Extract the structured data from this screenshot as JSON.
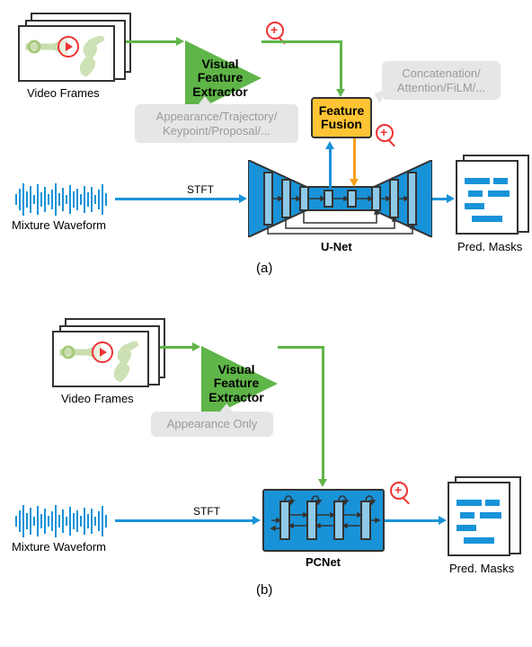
{
  "panel_a": {
    "video_frames_label": "Video Frames",
    "vfe_label": "Visual\nFeature\nExtractor",
    "vfe_callout": "Appearance/Trajectory/\nKeypoint/Proposal/...",
    "fusion_label": "Feature\nFusion",
    "fusion_callout": "Concatenation/\nAttention/FiLM/...",
    "mixture_label": "Mixture Waveform",
    "stft_label": "STFT",
    "net_label": "U-Net",
    "pred_label": "Pred. Masks",
    "subfig": "(a)"
  },
  "panel_b": {
    "video_frames_label": "Video Frames",
    "vfe_label": "Visual\nFeature\nExtractor",
    "vfe_callout": "Appearance Only",
    "mixture_label": "Mixture Waveform",
    "stft_label": "STFT",
    "net_label": "PCNet",
    "pred_label": "Pred. Masks",
    "subfig": "(b)"
  },
  "colors": {
    "green": "#5fb548",
    "blue": "#1993d8",
    "orange": "#ffc433",
    "arrow_green": "#5fb548",
    "arrow_blue": "#1993d8",
    "arrow_orange": "#f7a11a"
  },
  "icons": {
    "magnifier": "magnifier-plus-icon",
    "play": "play-icon",
    "trumpet": "trumpet-icon",
    "violin": "violin-icon"
  }
}
